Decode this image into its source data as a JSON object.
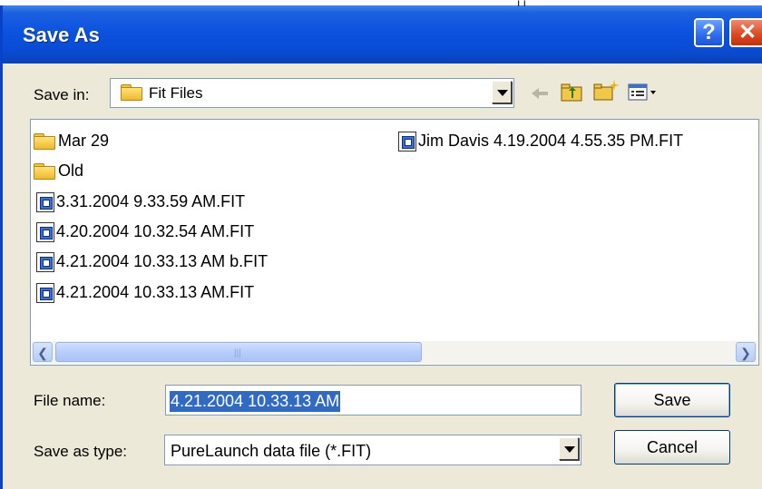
{
  "window": {
    "title": "Save As",
    "help_glyph": "?",
    "close_glyph": "✕"
  },
  "top_artifact": "ı ı",
  "save_in": {
    "label": "Save in:",
    "value": "Fit Files",
    "toolbar_icons": [
      "back-arrow-icon",
      "up-folder-icon",
      "new-folder-icon",
      "view-menu-icon"
    ]
  },
  "files": {
    "items": [
      {
        "name": "Mar 29",
        "type": "folder"
      },
      {
        "name": "Old",
        "type": "folder"
      },
      {
        "name": "3.31.2004 9.33.59 AM.FIT",
        "type": "file"
      },
      {
        "name": "4.20.2004 10.32.54 AM.FIT",
        "type": "file"
      },
      {
        "name": "4.21.2004 10.33.13 AM b.FIT",
        "type": "file"
      },
      {
        "name": "4.21.2004 10.33.13 AM.FIT",
        "type": "file"
      },
      {
        "name": "Jim Davis 4.19.2004 4.55.35 PM.FIT",
        "type": "file"
      }
    ]
  },
  "scrollbar": {
    "left_glyph": "❮",
    "right_glyph": "❯",
    "grip": "|||"
  },
  "file_name": {
    "label": "File name:",
    "value": "4.21.2004 10.33.13 AM"
  },
  "save_as_type": {
    "label": "Save as type:",
    "value": "PureLaunch data file (*.FIT)"
  },
  "buttons": {
    "save": "Save",
    "cancel": "Cancel"
  },
  "colors": {
    "title_bar": "#0a4cd4",
    "dialog_bg": "#ece9d8",
    "selection": "#316ac5"
  }
}
